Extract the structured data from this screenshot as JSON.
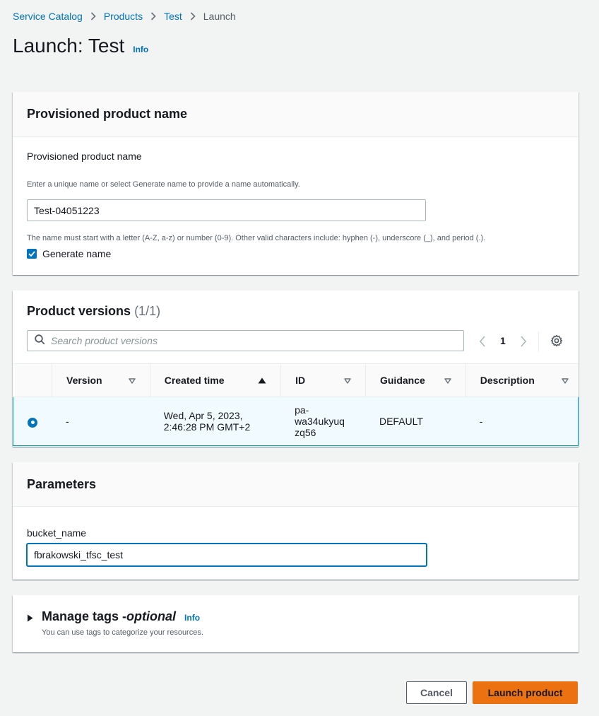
{
  "breadcrumb": {
    "items": [
      "Service Catalog",
      "Products",
      "Test"
    ],
    "current": "Launch"
  },
  "page": {
    "title": "Launch: Test",
    "info": "Info"
  },
  "name_panel": {
    "header": "Provisioned product name",
    "field_label": "Provisioned product name",
    "description": "Enter a unique name or select Generate name to provide a name automatically.",
    "value": "Test-04051223",
    "constraint": "The name must start with a letter (A-Z, a-z) or number (0-9). Other valid characters include: hyphen (-), underscore (_), and period (.).",
    "generate_label": "Generate name",
    "generate_checked": true
  },
  "versions_panel": {
    "header": "Product versions",
    "count": "(1/1)",
    "search_placeholder": "Search product versions",
    "page": "1",
    "columns": [
      "Version",
      "Created time",
      "ID",
      "Guidance",
      "Description"
    ],
    "sorted_column": "Created time",
    "rows": [
      {
        "selected": true,
        "version": "-",
        "created_line1": "Wed, Apr 5, 2023,",
        "created_line2": "2:46:28 PM GMT+2",
        "id_line1": "pa-",
        "id_line2": "wa34ukyuq",
        "id_line3": "zq56",
        "guidance": "DEFAULT",
        "description": "-"
      }
    ]
  },
  "params_panel": {
    "header": "Parameters",
    "field_label": "bucket_name",
    "value": "fbrakowski_tfsc_test"
  },
  "tags_panel": {
    "title_main": "Manage tags - ",
    "title_optional": "optional",
    "info": "Info",
    "description": "You can use tags to categorize your resources."
  },
  "actions": {
    "cancel": "Cancel",
    "launch": "Launch product"
  },
  "colors": {
    "link": "#0073bb",
    "primary_button": "#ec7211",
    "selected_row_bg": "#f1faff",
    "selected_row_border": "#00a1c9"
  }
}
